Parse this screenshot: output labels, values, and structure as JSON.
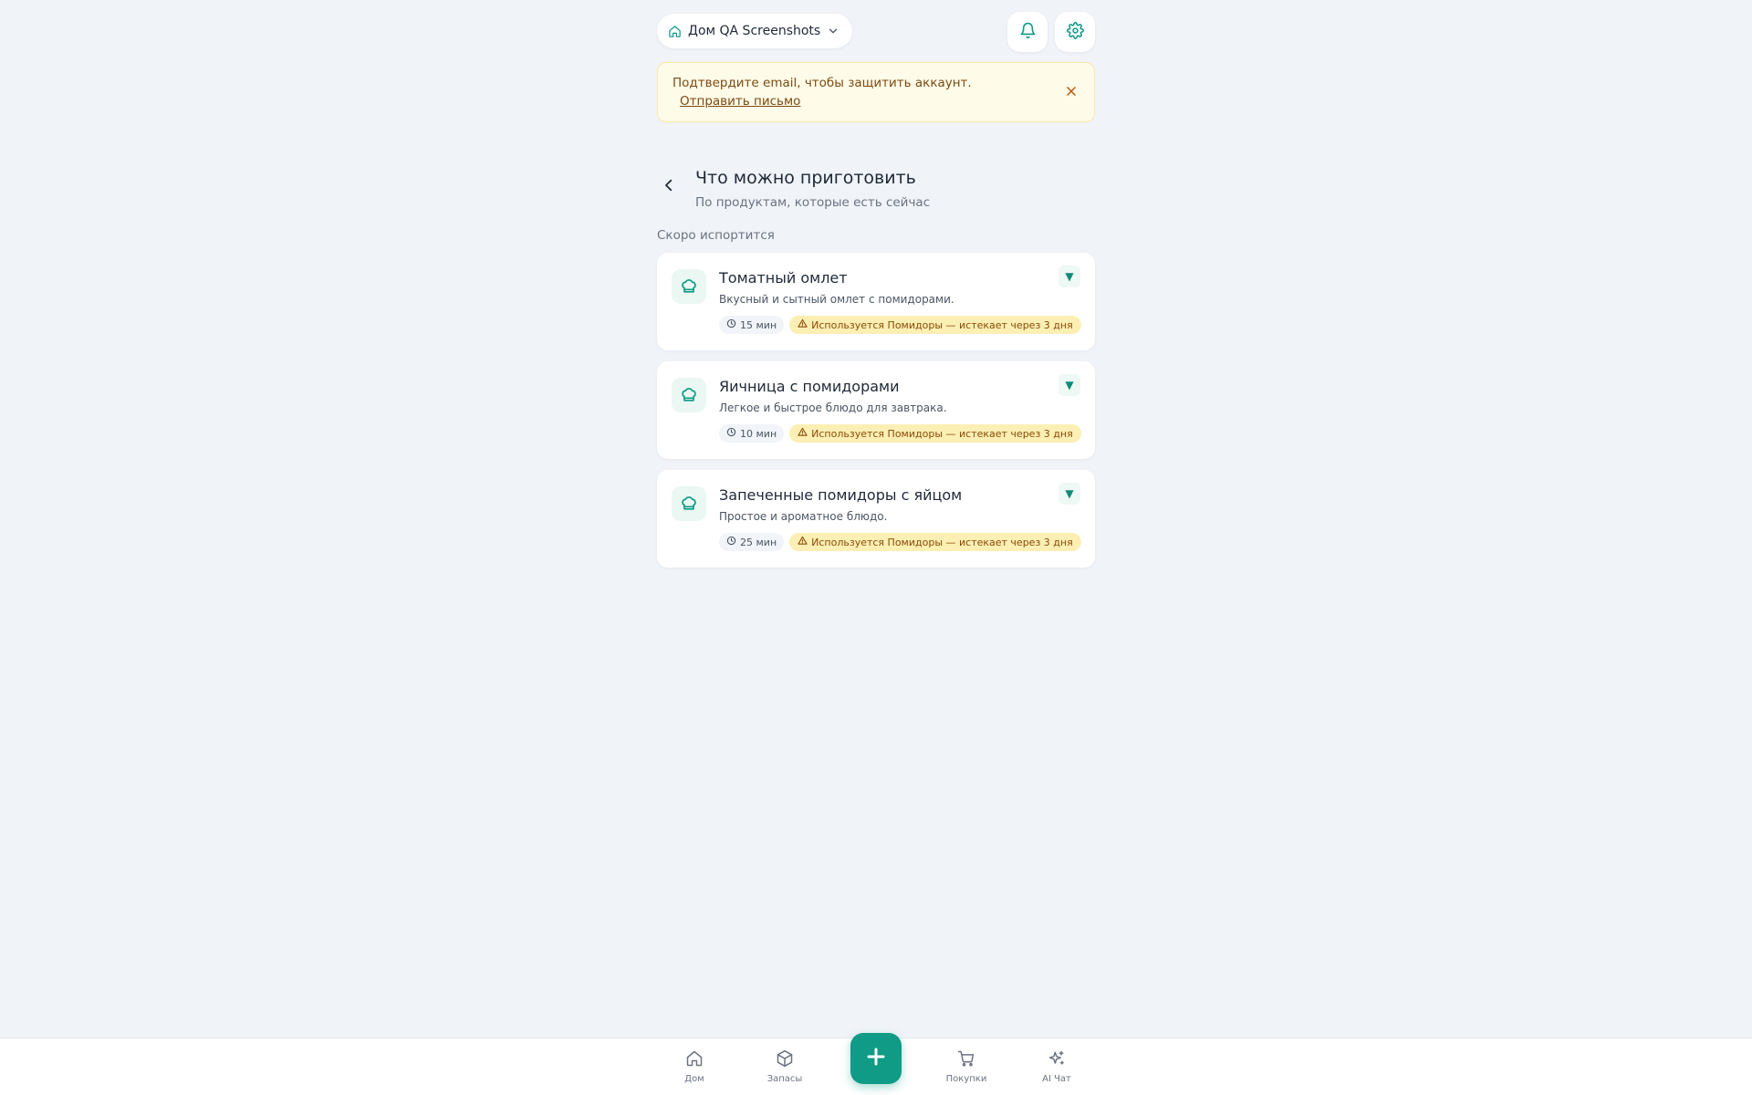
{
  "house_switcher": {
    "label": "Дом QA Screenshots"
  },
  "banner": {
    "text": "Подтвердите email, чтобы защитить аккаунт.",
    "link": "Отправить письмо"
  },
  "header": {
    "title": "Что можно приготовить",
    "subtitle": "По продуктам, которые есть сейчас"
  },
  "section_label": "Скоро испортится",
  "recipes": [
    {
      "title": "Томатный омлет",
      "description": "Вкусный и сытный омлет с помидорами.",
      "time": "15 мин",
      "warning": "Используется Помидоры — истекает через 3 дня"
    },
    {
      "title": "Яичница с помидорами",
      "description": "Легкое и быстрое блюдо для завтрака.",
      "time": "10 мин",
      "warning": "Используется Помидоры — истекает через 3 дня"
    },
    {
      "title": "Запеченные помидоры с яйцом",
      "description": "Простое и ароматное блюдо.",
      "time": "25 мин",
      "warning": "Используется Помидоры — истекает через 3 дня"
    }
  ],
  "expand_symbol": "▼",
  "bottom_nav": {
    "items": [
      {
        "label": "Дом",
        "icon": "home-icon"
      },
      {
        "label": "Запасы",
        "icon": "box-icon"
      },
      {
        "label": "Покупки",
        "icon": "cart-icon"
      },
      {
        "label": "AI Чат",
        "icon": "sparkles-icon"
      }
    ],
    "fab_icon": "plus-icon"
  },
  "colors": {
    "accent": "#0f9b85",
    "background": "#f0f3f8",
    "banner_bg": "#fefbe8",
    "warning_tag_bg": "#fcefb4"
  }
}
